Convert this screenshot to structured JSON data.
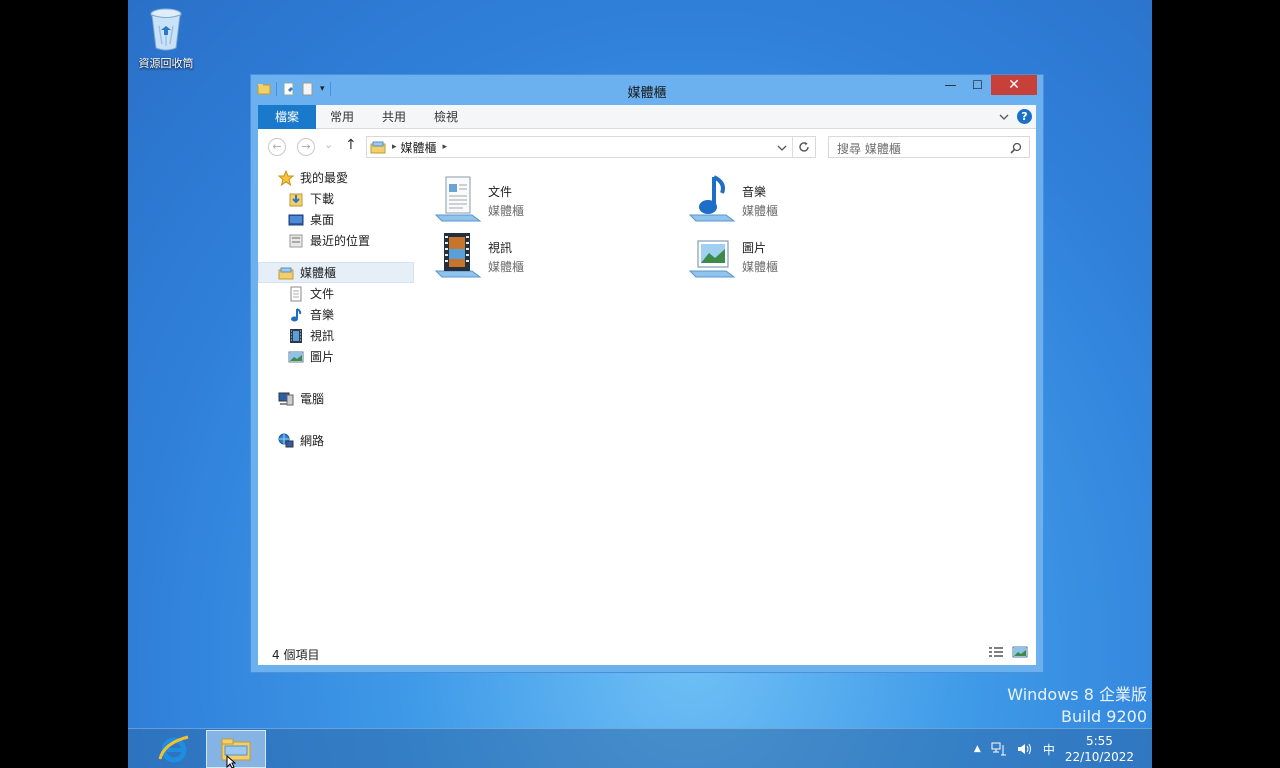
{
  "desktop": {
    "recycle_bin_label": "資源回收筒"
  },
  "window": {
    "title": "媒體櫃",
    "minimize": "—",
    "maximize": "☐",
    "close": "✕"
  },
  "ribbon": {
    "tabs": [
      "檔案",
      "常用",
      "共用",
      "檢視"
    ],
    "expand_icon": "chevron-down-icon",
    "help": "?"
  },
  "nav": {
    "back": "←",
    "forward": "→",
    "recent": "⌄",
    "up": "↑",
    "address": "媒體櫃",
    "search_placeholder": "搜尋 媒體櫃"
  },
  "navpane": {
    "favorites_header": "我的最愛",
    "favorites": [
      "下載",
      "桌面",
      "最近的位置"
    ],
    "libraries_header": "媒體櫃",
    "libraries": [
      "文件",
      "音樂",
      "視訊",
      "圖片"
    ],
    "computer": "電腦",
    "network": "網路"
  },
  "content": {
    "items": [
      {
        "name": "文件",
        "type": "媒體櫃"
      },
      {
        "name": "音樂",
        "type": "媒體櫃"
      },
      {
        "name": "視訊",
        "type": "媒體櫃"
      },
      {
        "name": "圖片",
        "type": "媒體櫃"
      }
    ]
  },
  "status": {
    "count": "4 個項目"
  },
  "watermark": {
    "line1": "Windows 8 企業版",
    "line2": "Build 9200"
  },
  "taskbar": {
    "ime": "中",
    "time": "5:55",
    "date": "22/10/2022"
  }
}
